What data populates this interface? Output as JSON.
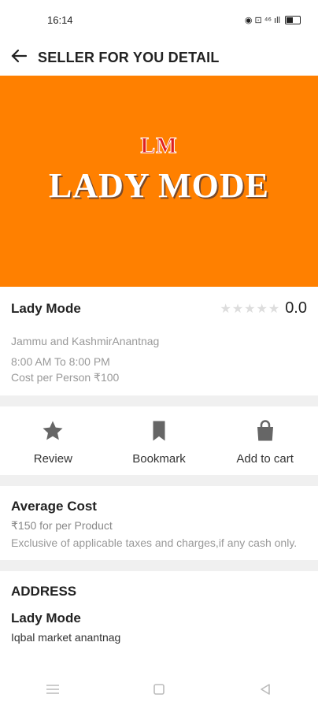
{
  "status": {
    "time": "16:14",
    "icons_text": "◉ ⊡ ⁴⁶ ıll"
  },
  "header": {
    "title": "SELLER FOR YOU DETAIL"
  },
  "banner": {
    "logo_small": "LM",
    "logo_big": "LADY MODE",
    "bg": "#FF8000"
  },
  "shop": {
    "name": "Lady Mode",
    "rating": "0.0",
    "stars": "★★★★★",
    "location": "Jammu and KashmirAnantnag",
    "hours": "8:00 AM To 8:00 PM",
    "cost_per_person": "Cost per Person ₹100"
  },
  "actions": {
    "review": "Review",
    "bookmark": "Bookmark",
    "add_to_cart": "Add to cart"
  },
  "average_cost": {
    "title": "Average Cost",
    "price": "₹150 for per Product",
    "note": "Exclusive of applicable taxes and charges,if any cash only."
  },
  "address": {
    "title": "ADDRESS",
    "name": "Lady Mode",
    "line": "Iqbal market anantnag"
  }
}
